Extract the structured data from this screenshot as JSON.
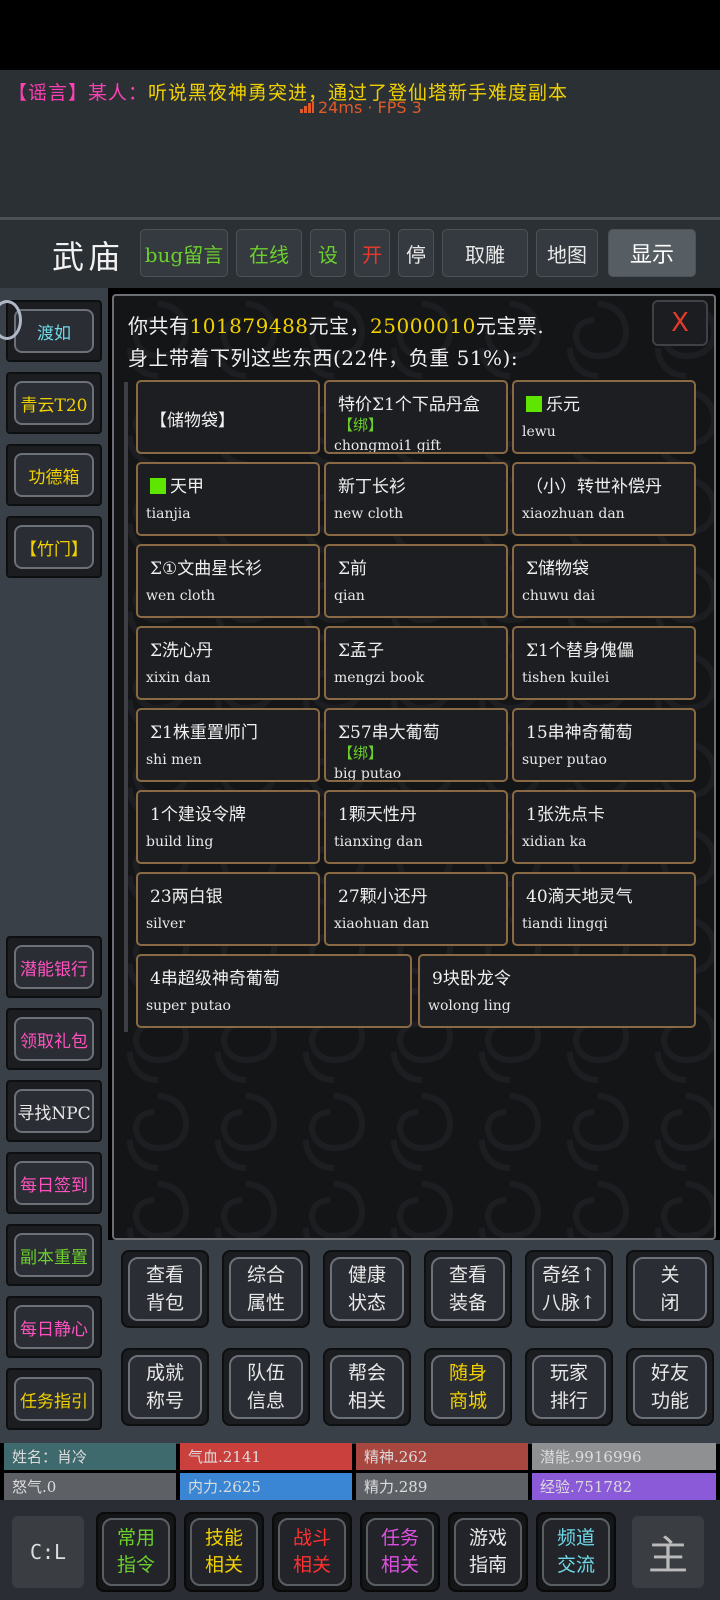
{
  "rumor": {
    "tag": "【谣言】",
    "who": "某人：",
    "message": "听说黑夜神勇突进，通过了登仙塔新手难度副本"
  },
  "network": {
    "ping": "24ms",
    "fps": "· FPS 3"
  },
  "header": {
    "location": "武庙",
    "buttons": {
      "bug": "bug留言",
      "online": "在线",
      "settings": "设",
      "open": "开",
      "stop": "停",
      "cancel_follow": "取雕",
      "map": "地图",
      "display": "显示"
    }
  },
  "left_buttons": {
    "b1": "渡如",
    "b2": "青云T20",
    "b3": "功德箱",
    "b4": "【竹门】",
    "b5": "潜能银行",
    "b6": "领取礼包",
    "b7": "寻找NPC",
    "b8": "每日签到",
    "b9": "副本重置",
    "b10": "每日静心",
    "b11": "任务指引"
  },
  "inventory": {
    "summary_prefix": "你共有",
    "gold": "101879488",
    "gold_unit": "元宝，",
    "tickets": "25000010",
    "ticket_unit": "元宝票.",
    "summary_line2": "身上带着下列这些东西(22件，负重 51%):",
    "close": "X",
    "items": [
      {
        "name": "【储物袋】",
        "code": ""
      },
      {
        "name": "特价Σ1个下品丹盒",
        "name2": "【绑】",
        "code": "chongmoi1 gift"
      },
      {
        "name": "乐元",
        "code": "lewu"
      },
      {
        "name": "天甲",
        "code": "tianjia"
      },
      {
        "name": "新丁长衫",
        "code": "new cloth"
      },
      {
        "name": "（小）转世补偿丹",
        "code": "xiaozhuan dan"
      },
      {
        "name": "Σ①文曲星长衫",
        "code": "wen cloth"
      },
      {
        "name": "Σ前",
        "code": "qian"
      },
      {
        "name": "Σ储物袋",
        "code": "chuwu dai"
      },
      {
        "name": "Σ洗心丹",
        "code": "xixin dan"
      },
      {
        "name": "Σ孟子",
        "code": "mengzi book"
      },
      {
        "name": "Σ1个替身傀儡",
        "code": "tishen kuilei"
      },
      {
        "name": "Σ1株重置师门",
        "code": "shi men"
      },
      {
        "name": "Σ57串大葡萄",
        "name2": "【绑】",
        "code": "big putao"
      },
      {
        "name": "15串神奇葡萄",
        "code": "super putao"
      },
      {
        "name": "1个建设令牌",
        "code": "build ling"
      },
      {
        "name": "1颗天性丹",
        "code": "tianxing dan"
      },
      {
        "name": "1张洗点卡",
        "code": "xidian ka"
      },
      {
        "name": "23两白银",
        "code": "silver"
      },
      {
        "name": "27颗小还丹",
        "code": "xiaohuan dan"
      },
      {
        "name": "40滴天地灵气",
        "code": "tiandi lingqi"
      },
      {
        "name": "4串超级神奇葡萄",
        "code": "super putao"
      },
      {
        "name": "9块卧龙令",
        "code": "wolong ling"
      }
    ]
  },
  "func_buttons": [
    [
      "查看",
      "背包"
    ],
    [
      "综合",
      "属性"
    ],
    [
      "健康",
      "状态"
    ],
    [
      "查看",
      "装备"
    ],
    [
      "奇经↑",
      "八脉↑"
    ],
    [
      "关",
      "闭"
    ],
    [
      "成就",
      "称号"
    ],
    [
      "队伍",
      "信息"
    ],
    [
      "帮会",
      "相关"
    ],
    [
      "随身",
      "商城"
    ],
    [
      "玩家",
      "排行"
    ],
    [
      "好友",
      "功能"
    ]
  ],
  "stats": {
    "name": "姓名：肖冷",
    "hp": "气血.2141",
    "spirit": "精神.262",
    "potential": "潜能.9916996",
    "rage": "怒气.0",
    "neili": "内力.2625",
    "energy": "精力.289",
    "exp": "经验.751782"
  },
  "tabs": [
    [
      "常用",
      "指令"
    ],
    [
      "技能",
      "相关"
    ],
    [
      "战斗",
      "相关"
    ],
    [
      "任务",
      "相关"
    ],
    [
      "游戏",
      "指南"
    ],
    [
      "频道",
      "交流"
    ]
  ],
  "icons": {
    "cmd": "C:L",
    "right": "主"
  },
  "colors": {
    "green": "#6ccf2c",
    "yellow": "#f0d000",
    "pink": "#ff52c0",
    "red": "#e43a2c"
  }
}
